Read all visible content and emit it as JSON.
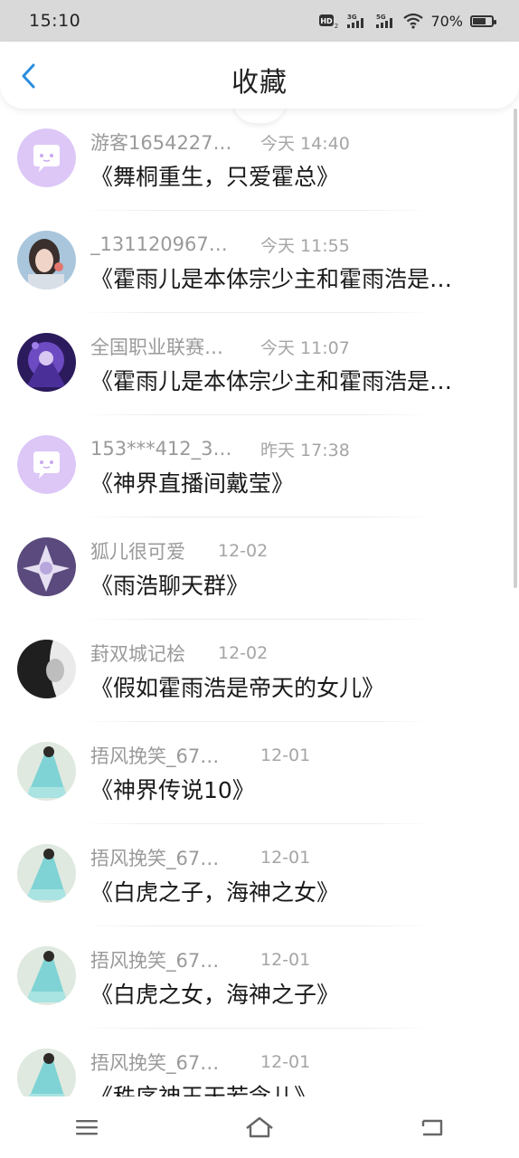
{
  "status_bar": {
    "time": "15:10",
    "network_hd": "HD2",
    "network_3g": "3G",
    "network_5g": "5G",
    "battery_percent_text": "70%",
    "battery_level": 0.7
  },
  "header": {
    "title": "收藏",
    "back_icon": "chevron-left-icon",
    "accent_color": "#2a8de0"
  },
  "favorites": [
    {
      "username": "游客1654227…",
      "time": "今天 14:40",
      "title": "《舞桐重生，只爱霍总》",
      "avatar": "default"
    },
    {
      "username": "_131120967…",
      "time": "今天 11:55",
      "title": "《霍雨儿是本体宗少主和霍雨浩是…",
      "avatar": "photo-girl"
    },
    {
      "username": "全国职业联赛…",
      "time": "今天 11:07",
      "title": "《霍雨儿是本体宗少主和霍雨浩是…",
      "avatar": "anime-purple"
    },
    {
      "username": "153***412_3…",
      "time": "昨天 17:38",
      "title": "《神界直播间戴莹》",
      "avatar": "default"
    },
    {
      "username": "狐儿很可爱",
      "time": "12-02",
      "title": "《雨浩聊天群》",
      "avatar": "anime-fox"
    },
    {
      "username": "葑双城记桧",
      "time": "12-02",
      "title": "《假如霍雨浩是帝天的女儿》",
      "avatar": "photo-bw"
    },
    {
      "username": "捂风挽笑_67…",
      "time": "12-01",
      "title": "《神界传说10》",
      "avatar": "teal-dress"
    },
    {
      "username": "捂风挽笑_67…",
      "time": "12-01",
      "title": "《白虎之子，海神之女》",
      "avatar": "teal-dress"
    },
    {
      "username": "捂风挽笑_67…",
      "time": "12-01",
      "title": "《白虎之女，海神之子》",
      "avatar": "teal-dress"
    },
    {
      "username": "捂风挽笑_67…",
      "time": "12-01",
      "title": "《秩序神王天若念儿》",
      "avatar": "teal-dress"
    }
  ],
  "nav": {
    "menu_icon": "menu-icon",
    "home_icon": "home-icon",
    "back_icon": "back-icon"
  }
}
